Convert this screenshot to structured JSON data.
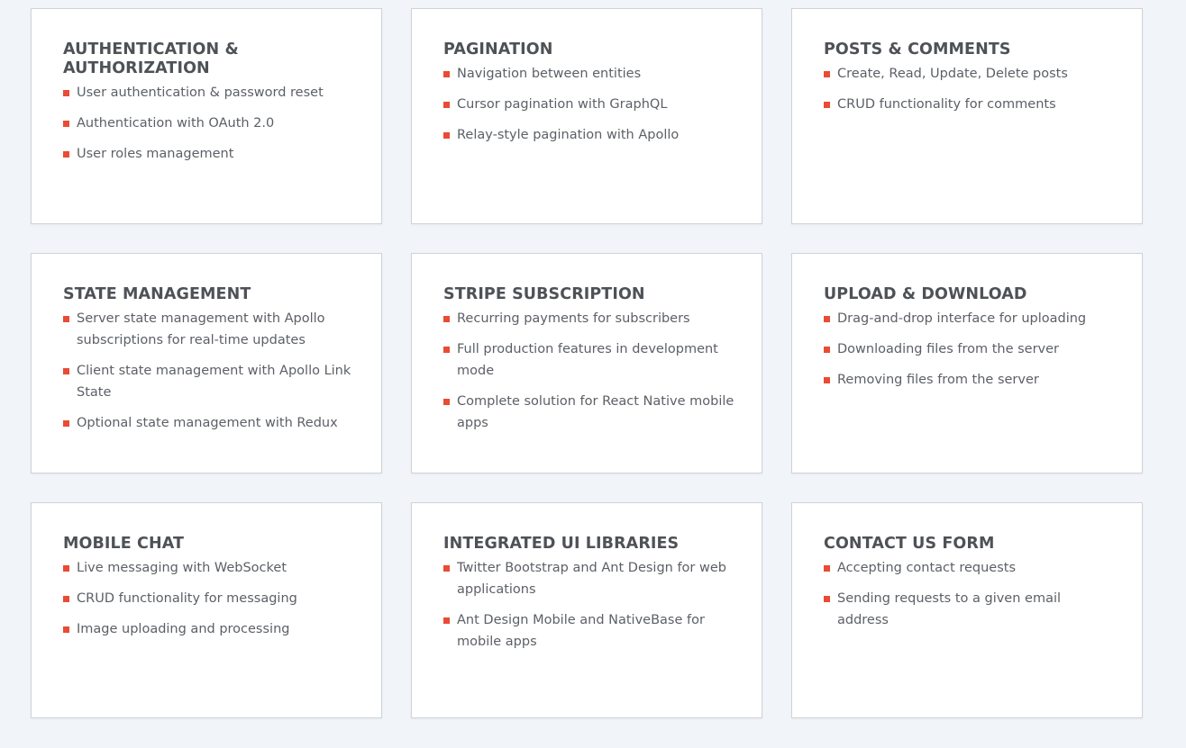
{
  "accent_color": "#e94b35",
  "cards": [
    {
      "title": "AUTHENTICATION & AUTHORIZATION",
      "items": [
        "User authentication & password reset",
        "Authentication with OAuth 2.0",
        "User roles management"
      ]
    },
    {
      "title": "PAGINATION",
      "items": [
        "Navigation between entities",
        "Cursor pagination with GraphQL",
        "Relay-style pagination with Apollo"
      ]
    },
    {
      "title": "POSTS & COMMENTS",
      "items": [
        "Create, Read, Update, Delete posts",
        "CRUD functionality for comments"
      ]
    },
    {
      "title": "STATE MANAGEMENT",
      "items": [
        "Server state management with Apollo subscriptions for real-time updates",
        "Client state management with Apollo Link State",
        "Optional state management with Redux"
      ]
    },
    {
      "title": "STRIPE SUBSCRIPTION",
      "items": [
        "Recurring payments for subscribers",
        "Full production features in development mode",
        "Complete solution for React Native mobile apps"
      ]
    },
    {
      "title": "UPLOAD & DOWNLOAD",
      "items": [
        "Drag-and-drop interface for uploading",
        "Downloading files from the server",
        "Removing files from the server"
      ]
    },
    {
      "title": "MOBILE CHAT",
      "items": [
        "Live messaging with WebSocket",
        "CRUD functionality for messaging",
        "Image uploading and processing"
      ]
    },
    {
      "title": "INTEGRATED UI LIBRARIES",
      "items": [
        "Twitter Bootstrap and Ant Design for web applications",
        "Ant Design Mobile and NativeBase for mobile apps"
      ]
    },
    {
      "title": "CONTACT US FORM",
      "items": [
        "Accepting contact requests",
        "Sending requests to a given email address"
      ]
    }
  ]
}
